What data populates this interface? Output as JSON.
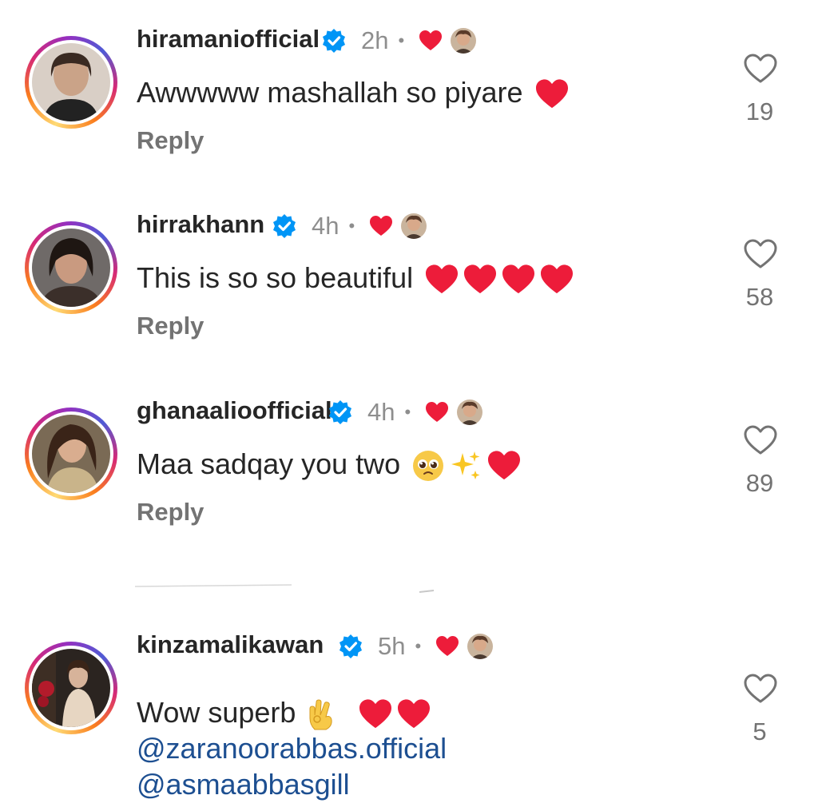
{
  "comments": [
    {
      "username": "hiramaniofficial",
      "time": "2h",
      "dot": "•",
      "text": "Awwwww mashallah so piyare",
      "reply": "Reply",
      "likes": "19"
    },
    {
      "username": "hirrakhann",
      "time": "4h",
      "dot": "•",
      "text": "This is so so beautiful",
      "reply": "Reply",
      "likes": "58"
    },
    {
      "username": "ghanaalioofficial",
      "time": "4h",
      "dot": "•",
      "text": "Maa sadqay you two",
      "reply": "Reply",
      "likes": "89"
    },
    {
      "username": "kinzamalikawan",
      "time": "5h",
      "dot": "•",
      "text": "Wow superb",
      "mentions": [
        "@zaranoorabbas.official",
        "@asmaabbasgill"
      ],
      "likes": "5"
    }
  ],
  "colors": {
    "heart_red": "#ed1c3a",
    "verified_blue": "#0095f6",
    "mention_blue": "#1d4f91"
  }
}
